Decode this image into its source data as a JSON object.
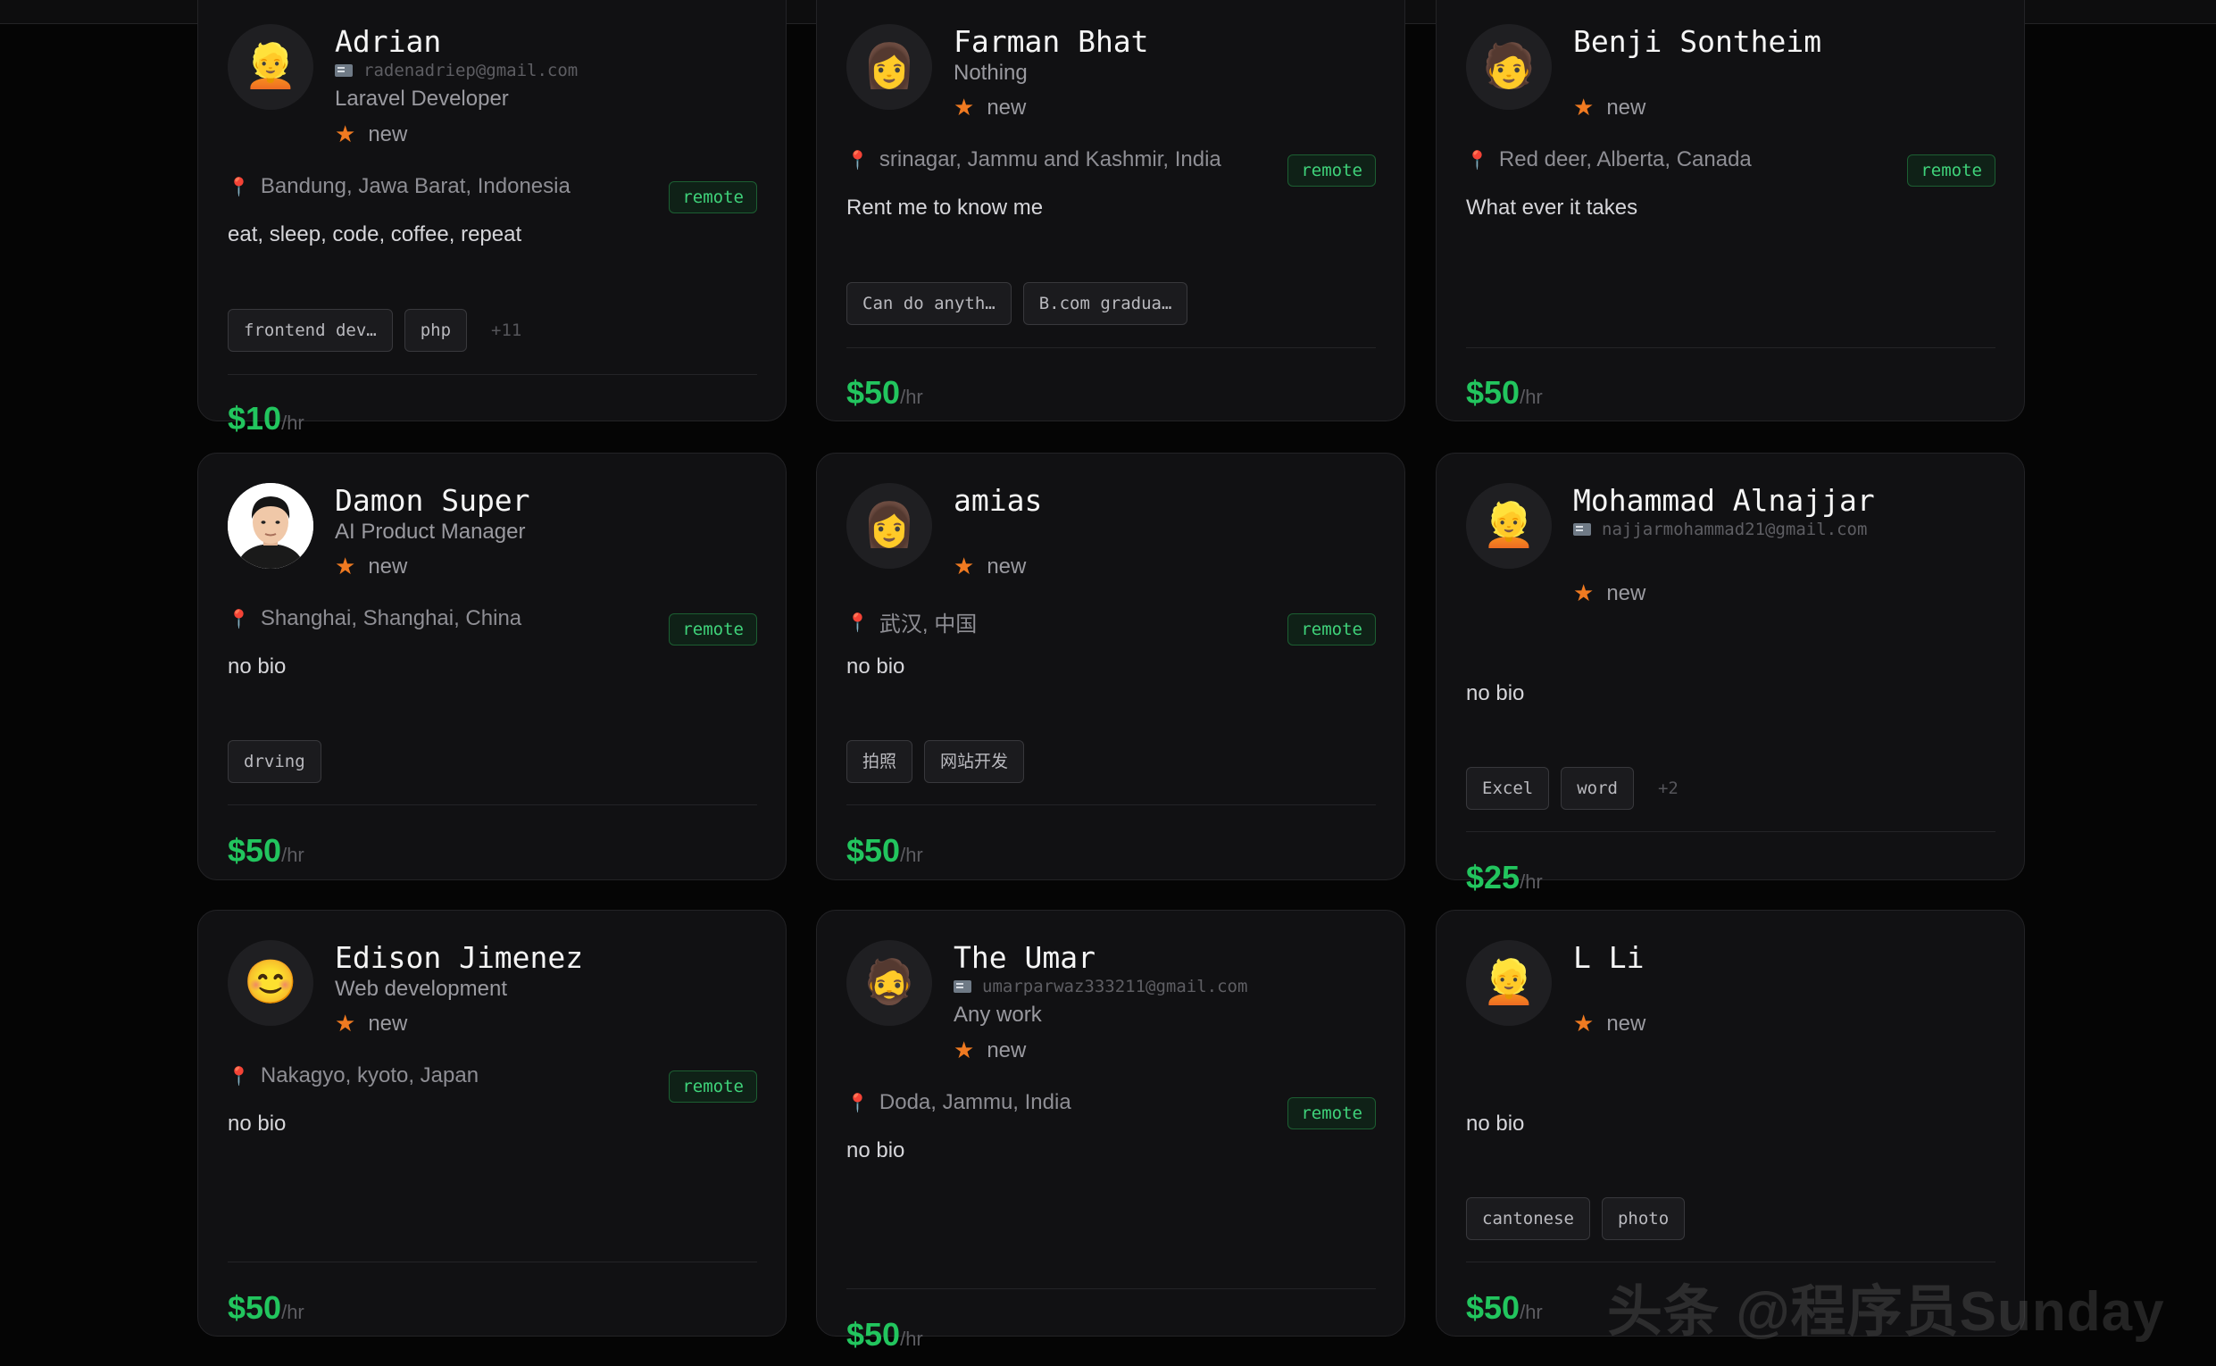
{
  "watermark": "头条 @程序员Sunday",
  "price_unit": "/hr",
  "remote_label": "remote",
  "cards": [
    {
      "name": "Adrian",
      "avatar": "👱",
      "email": "radenadriep@gmail.com",
      "title": "Laravel Developer",
      "rating": "new",
      "location": "Bandung, Jawa Barat, Indonesia",
      "bio": "eat, sleep, code, coffee, repeat",
      "tags": [
        "frontend dev…",
        "php"
      ],
      "more": "+11",
      "price": "$10"
    },
    {
      "name": "Farman Bhat",
      "avatar": "👩",
      "title": "Nothing",
      "rating": "new",
      "location": "srinagar, Jammu and Kashmir, India",
      "bio": "Rent me to know me",
      "tags": [
        "Can do anyth…",
        "B.com gradua…"
      ],
      "price": "$50"
    },
    {
      "name": "Benji Sontheim",
      "avatar": "🧑",
      "rating": "new",
      "location": "Red deer, Alberta, Canada",
      "bio": "What ever it takes",
      "price": "$50"
    },
    {
      "name": "Damon Super",
      "title": "AI Product Manager",
      "rating": "new",
      "location": "Shanghai, Shanghai, China",
      "bio": "no bio",
      "tags": [
        "drving"
      ],
      "price": "$50"
    },
    {
      "name": "amias",
      "avatar": "👩",
      "rating": "new",
      "location": "武汉, 中国",
      "bio": "no bio",
      "tags": [
        "拍照",
        "网站开发"
      ],
      "price": "$50"
    },
    {
      "name": "Mohammad Alnajjar",
      "avatar": "👱",
      "email": "najjarmohammad21@gmail.com",
      "rating": "new",
      "bio": "no bio",
      "tags": [
        "Excel",
        "word"
      ],
      "more": "+2",
      "price": "$25"
    },
    {
      "name": "Edison Jimenez",
      "avatar": "😊",
      "title": "Web development",
      "rating": "new",
      "location": "Nakagyo, kyoto, Japan",
      "bio": "no bio",
      "price": "$50"
    },
    {
      "name": "The Umar",
      "avatar": "🧔",
      "email": "umarparwaz333211@gmail.com",
      "title": "Any work",
      "rating": "new",
      "location": "Doda, Jammu, India",
      "bio": "no bio",
      "price": "$50"
    },
    {
      "name": "L Li",
      "avatar": "👱",
      "rating": "new",
      "bio": "no bio",
      "tags": [
        "cantonese",
        "photo"
      ],
      "price": "$50"
    }
  ]
}
